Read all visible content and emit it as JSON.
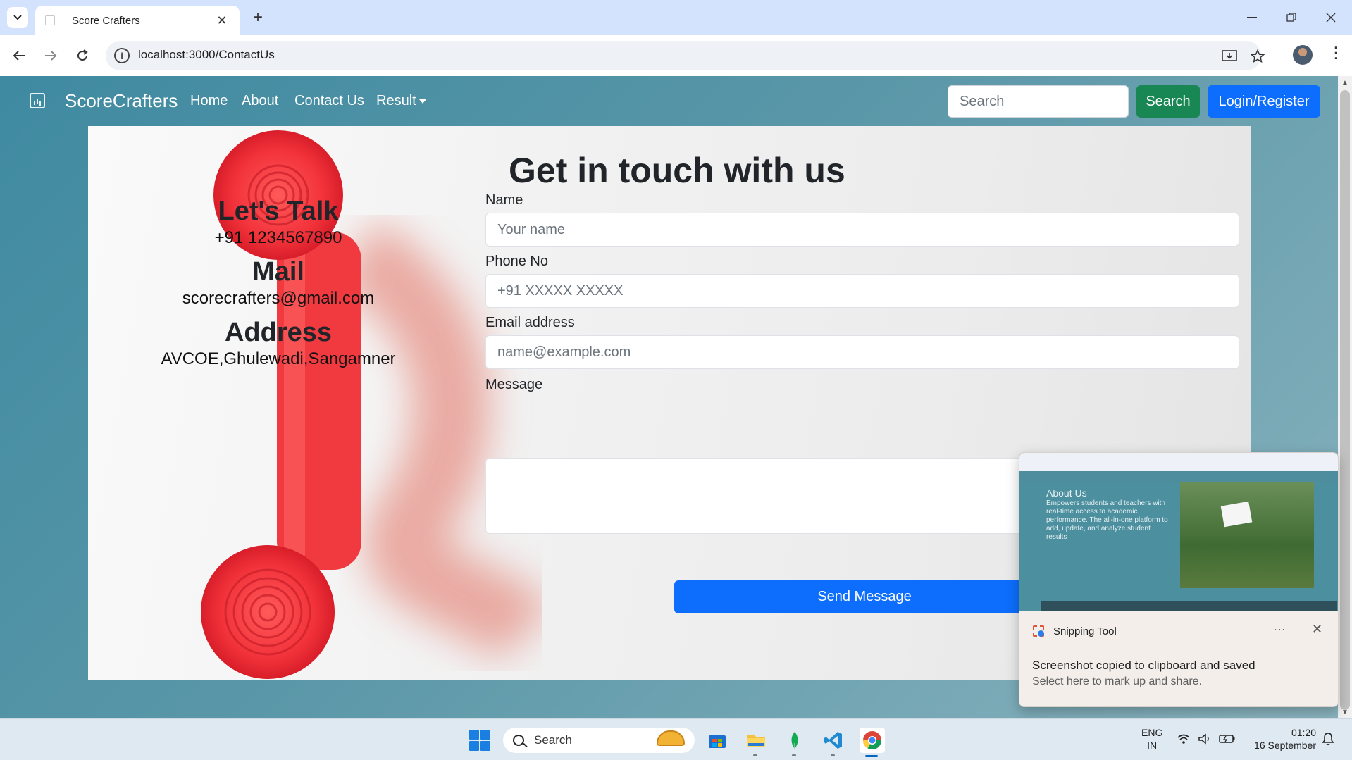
{
  "browser": {
    "tab_title": "Score Crafters",
    "url": "localhost:3000/ContactUs"
  },
  "site": {
    "brand": "ScoreCrafters",
    "nav": [
      "Home",
      "About",
      "Contact Us",
      "Result"
    ],
    "search_placeholder": "Search",
    "search_button": "Search",
    "login_button": "Login/Register",
    "colors": {
      "nav_bg": "#4e8fa0",
      "search_btn": "#198754",
      "primary": "#0d6efd"
    }
  },
  "contact_info": {
    "talk_heading": "Let's Talk",
    "phone": "+91 1234567890",
    "mail_heading": "Mail",
    "email": "scorecrafters@gmail.com",
    "address_heading": "Address",
    "address": "AVCOE,Ghulewadi,Sangamner"
  },
  "form": {
    "title": "Get in touch with us",
    "name_label": "Name",
    "name_placeholder": "Your name",
    "phone_label": "Phone No",
    "phone_placeholder": "+91 XXXXX XXXXX",
    "email_label": "Email address",
    "email_placeholder": "name@example.com",
    "message_label": "Message",
    "submit": "Send Message"
  },
  "toast": {
    "app": "Snipping Tool",
    "message": "Screenshot copied to clipboard and saved",
    "sub": "Select here to mark up and share.",
    "thumb_title": "About Us",
    "thumb_text": "Empowers students and teachers with real-time access to academic performance. The all-in-one platform to add, update, and analyze student results"
  },
  "taskbar": {
    "search": "Search",
    "lang_top": "ENG",
    "lang_bottom": "IN",
    "time": "01:20",
    "date": "16 September"
  }
}
